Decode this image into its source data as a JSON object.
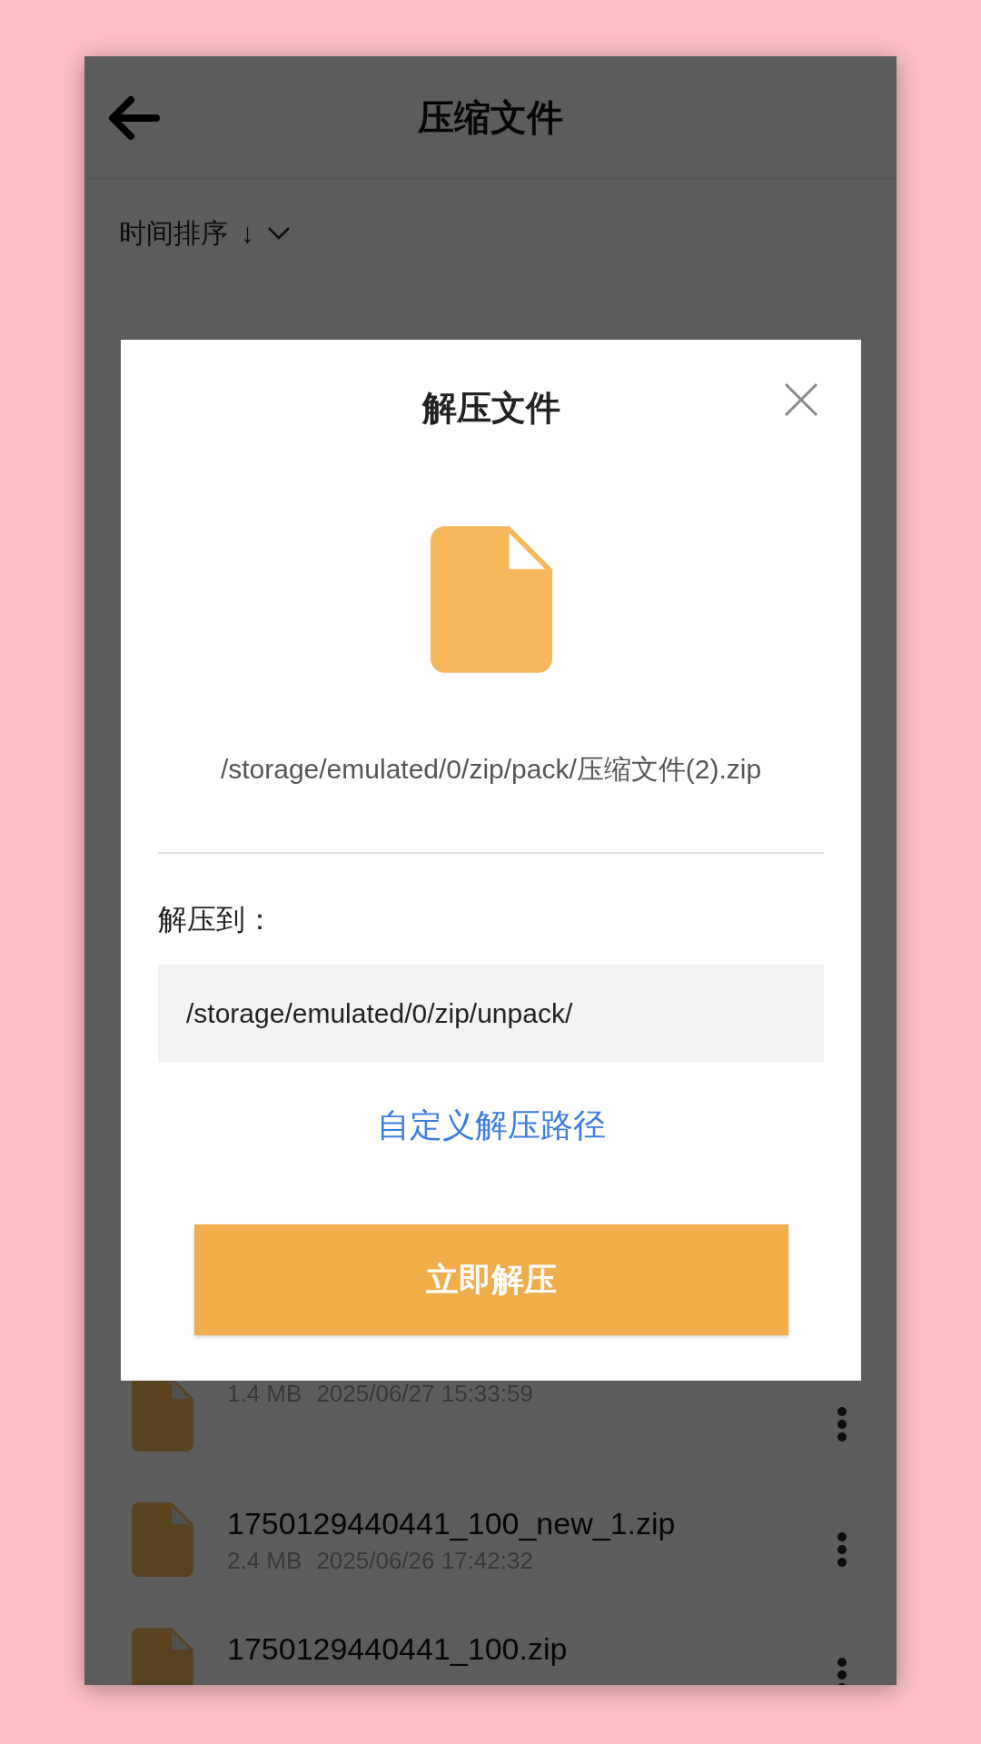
{
  "app_bar": {
    "title": "压缩文件"
  },
  "sort": {
    "label": "时间排序",
    "direction": "↓"
  },
  "files": [
    {
      "size": "1.4 MB",
      "modified": "2025/06/27 15:33:59"
    },
    {
      "name": "1750129440441_100_new_1.zip",
      "size": "2.4 MB",
      "modified": "2025/06/26 17:42:32"
    },
    {
      "name": "1750129440441_100.zip"
    }
  ],
  "dialog": {
    "title": "解压文件",
    "source_path": "/storage/emulated/0/zip/pack/压缩文件(2).zip",
    "destination_label": "解压到：",
    "destination_path": "/storage/emulated/0/zip/unpack/",
    "custom_path_link": "自定义解压路径",
    "confirm_button": "立即解压"
  }
}
